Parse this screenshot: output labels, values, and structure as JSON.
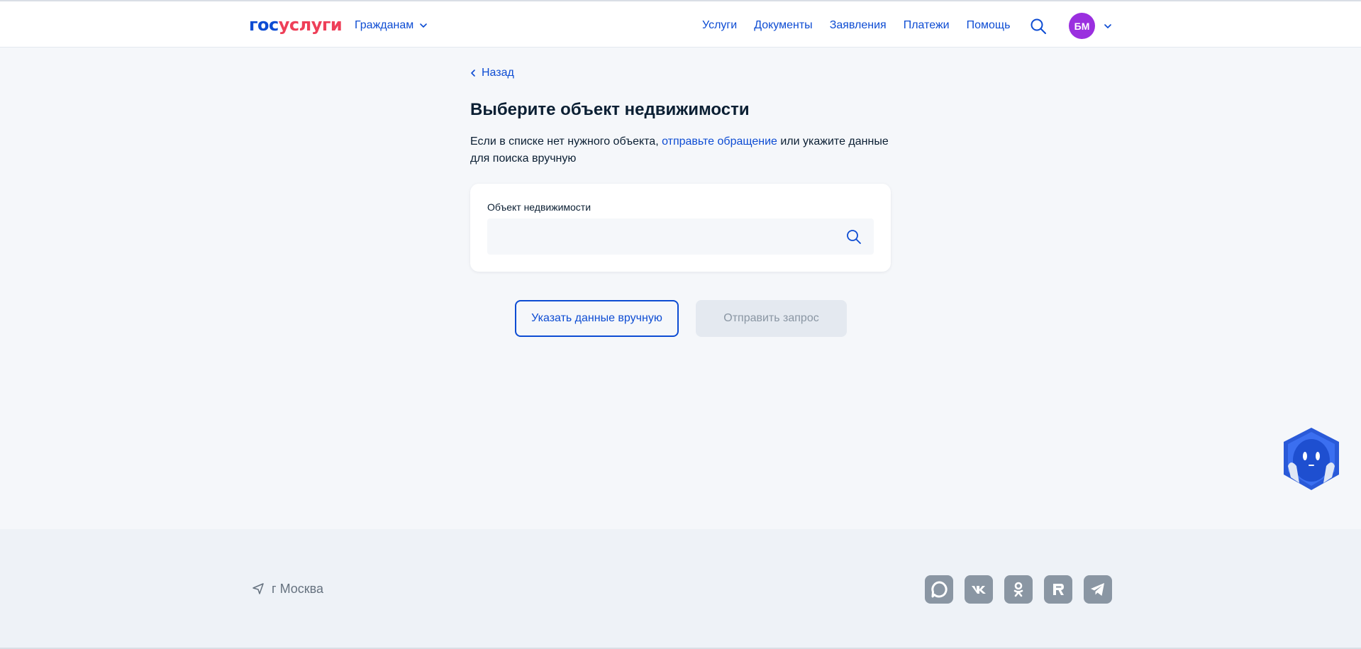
{
  "header": {
    "logo_part1": "гос",
    "logo_part2": "услуги",
    "audience_label": "Гражданам",
    "nav": [
      "Услуги",
      "Документы",
      "Заявления",
      "Платежи",
      "Помощь"
    ],
    "avatar_initials": "БМ"
  },
  "main": {
    "back_label": "Назад",
    "title": "Выберите объект недвижимости",
    "description_before": "Если в списке нет нужного объекта, ",
    "description_link": "отправьте обращение",
    "description_after": " или укажите данные для поиска вручную",
    "field_label": "Объект недвижимости",
    "field_value": "",
    "manual_button": "Указать данные вручную",
    "submit_button": "Отправить запрос",
    "submit_disabled": true
  },
  "footer": {
    "location": "г Москва",
    "socials": [
      "max-icon",
      "vk-icon",
      "ok-icon",
      "rutube-icon",
      "telegram-icon"
    ]
  },
  "colors": {
    "accent": "#0d4cd3",
    "logo_red": "#ee3f58",
    "avatar": "#9a2fdf",
    "page_bg": "#f5f7fa",
    "footer_bg": "#eef2f7",
    "disabled_bg": "#e4e9f0",
    "muted_text": "#8a96a3"
  }
}
